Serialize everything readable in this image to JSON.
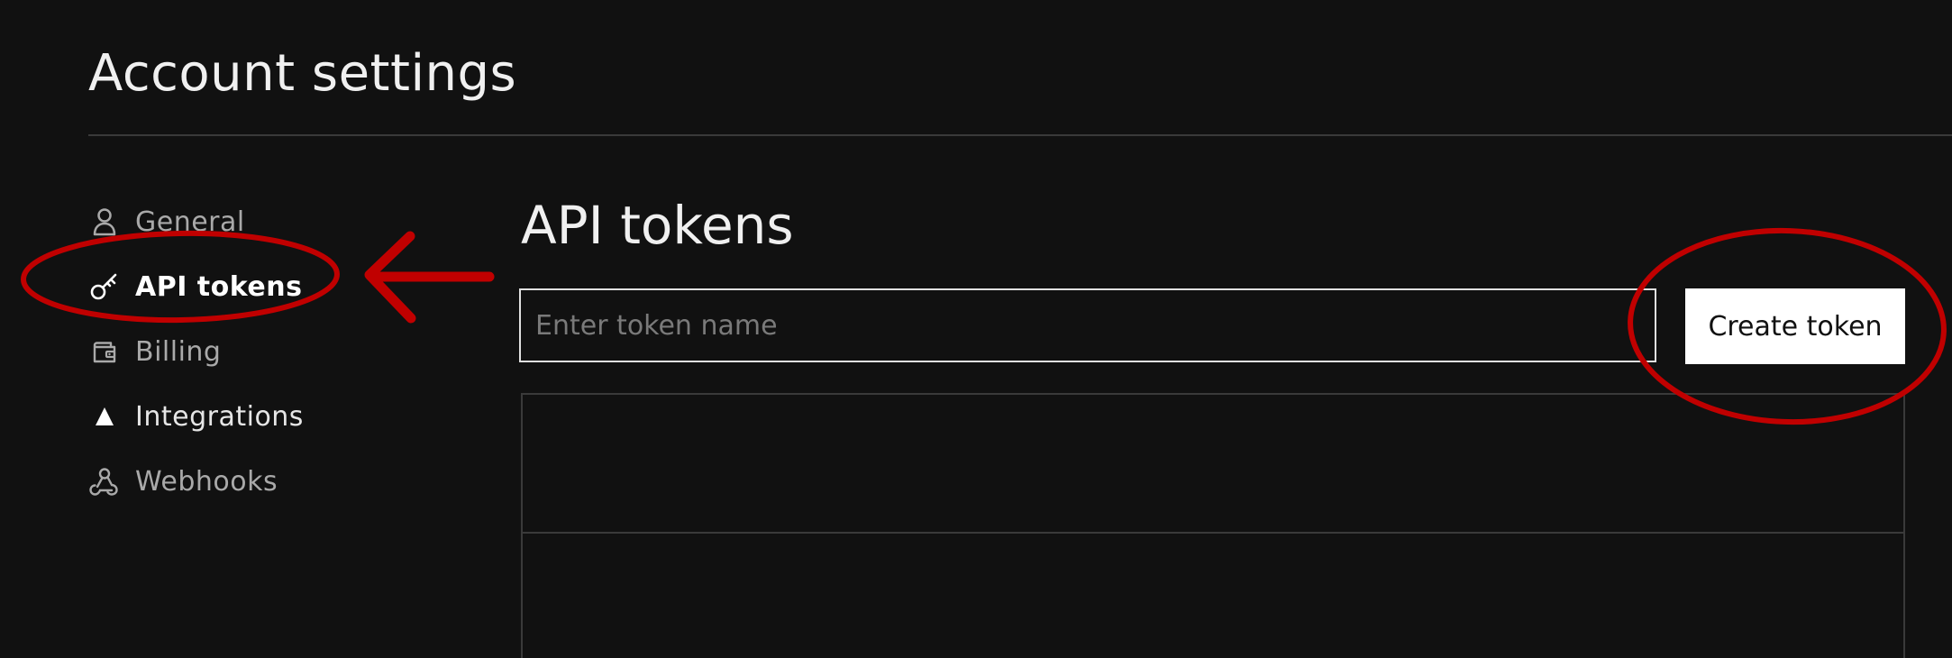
{
  "page": {
    "title": "Account settings"
  },
  "sidebar": {
    "items": [
      {
        "label": "General",
        "icon": "person-icon",
        "active": false
      },
      {
        "label": "API tokens",
        "icon": "key-icon",
        "active": true
      },
      {
        "label": "Billing",
        "icon": "wallet-icon",
        "active": false
      },
      {
        "label": "Integrations",
        "icon": "triangle-icon",
        "active": false
      },
      {
        "label": "Webhooks",
        "icon": "webhook-icon",
        "active": false
      }
    ]
  },
  "main": {
    "section_title": "API tokens",
    "token_input": {
      "placeholder": "Enter token name",
      "value": ""
    },
    "create_button_label": "Create token",
    "table": {
      "rows": [
        "",
        ""
      ]
    }
  },
  "annotations": {
    "color": "#c00000",
    "marks": [
      "arrow",
      "circle-around-api-tokens",
      "circle-around-create-token"
    ]
  },
  "colors": {
    "background": "#111111",
    "text": "#f0f0f0",
    "muted_text": "#a9a9a9",
    "button_bg": "#ffffff",
    "divider": "#3a3a3a"
  }
}
